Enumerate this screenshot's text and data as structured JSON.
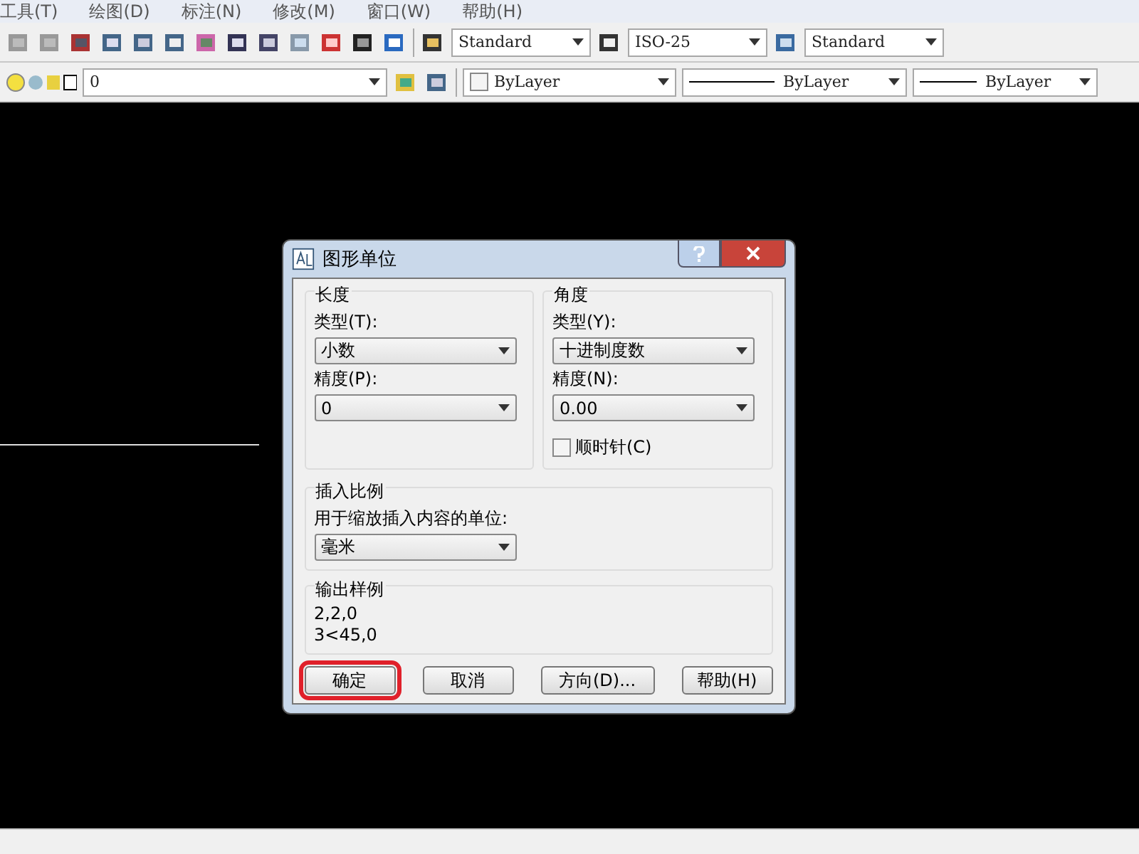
{
  "menu": [
    "工具(T)",
    "绘图(D)",
    "标注(N)",
    "修改(M)",
    "窗口(W)",
    "帮助(H)"
  ],
  "styles_toolbar": {
    "text_style": "Standard",
    "dim_style": "ISO-25",
    "table_style": "Standard"
  },
  "layers_toolbar": {
    "layer": "0",
    "color_control": "ByLayer",
    "linetype": "ByLayer",
    "lineweight": "ByLayer"
  },
  "dialog": {
    "title": "图形单位",
    "length": {
      "legend": "长度",
      "type_label": "类型(T):",
      "type": "小数",
      "precision_label": "精度(P):",
      "precision": "0"
    },
    "angle": {
      "legend": "角度",
      "type_label": "类型(Y):",
      "type": "十进制度数",
      "precision_label": "精度(N):",
      "precision": "0.00",
      "clockwise": {
        "label": "顺时针(C)",
        "checked": false
      }
    },
    "insert_scale": {
      "legend": "插入比例",
      "label": "用于缩放插入内容的单位:",
      "value": "毫米"
    },
    "sample_output": {
      "legend": "输出样例",
      "lines": [
        "2,2,0",
        "3<45,0"
      ]
    },
    "buttons": [
      {
        "label": "确定",
        "marked": true
      },
      {
        "label": "取消",
        "marked": false
      },
      {
        "label": "方向(D)...",
        "marked": false
      },
      {
        "label": "帮助(H)",
        "marked": false
      }
    ]
  }
}
